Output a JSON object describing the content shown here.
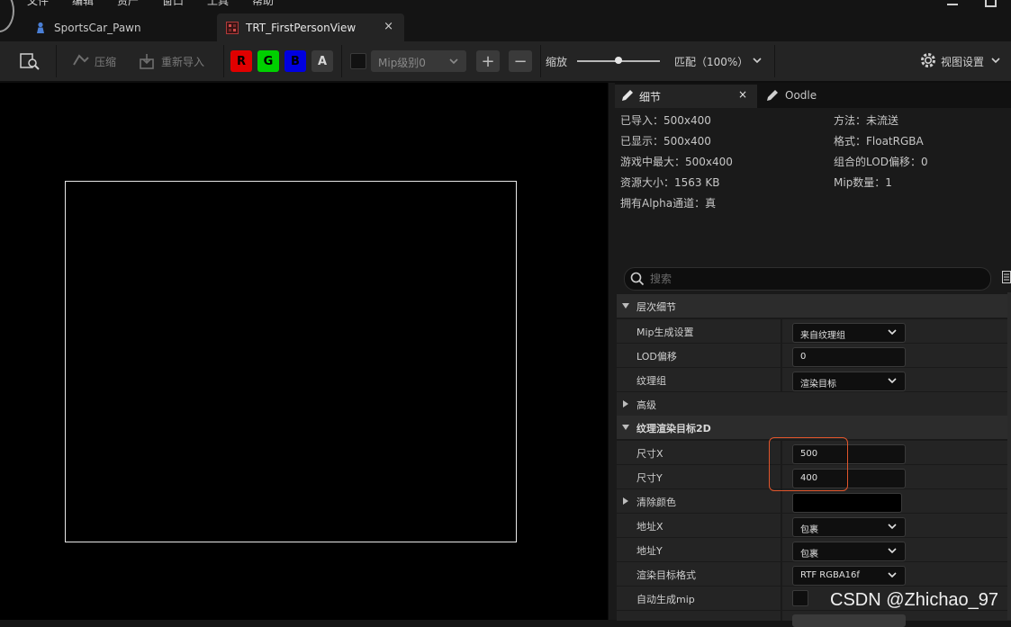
{
  "menu": {
    "items": [
      "文件",
      "编辑",
      "资产",
      "窗口",
      "工具",
      "帮助"
    ]
  },
  "tabs": [
    {
      "label": "SportsCar_Pawn",
      "icon": "pawn-icon"
    },
    {
      "label": "TRT_FirstPersonView",
      "icon": "render-target-icon",
      "close": "×"
    }
  ],
  "toolbar": {
    "compress_label": "压缩",
    "reimport_label": "重新导入",
    "channels": {
      "r": "R",
      "g": "G",
      "b": "B",
      "a": "A"
    },
    "mip_dropdown": "Mip级别0",
    "plus": "+",
    "minus": "−",
    "zoom_label": "缩放",
    "zoom_level": 0.5,
    "fit_label": "匹配（100%）",
    "view_settings_label": "视图设置"
  },
  "details_tabs": {
    "details": "细节",
    "close": "×",
    "oodle": "Oodle"
  },
  "info": {
    "imported": "已导入：500x400",
    "displayed": "已显示：500x400",
    "max_ingame": "游戏中最大：500x400",
    "resource_size": "资源大小：1563 KB",
    "has_alpha": "拥有Alpha通道：真",
    "method": "方法：未流送",
    "format": "格式：FloatRGBA",
    "lod_bias": "组合的LOD偏移：0",
    "mip_count": "Mip数量：1"
  },
  "search": {
    "placeholder": "搜索"
  },
  "sections": {
    "lod": {
      "title": "层次细节",
      "mip_gen_label": "Mip生成设置",
      "mip_gen_value": "来自纹理组",
      "lod_bias_label": "LOD偏移",
      "lod_bias_value": "0",
      "texture_group_label": "纹理组",
      "texture_group_value": "渲染目标"
    },
    "advanced": {
      "title": "高级"
    },
    "rt2d": {
      "title": "纹理渲染目标2D",
      "size_x_label": "尺寸X",
      "size_x_value": "500",
      "size_y_label": "尺寸Y",
      "size_y_value": "400",
      "clear_color_label": "清除颜色",
      "address_x_label": "地址X",
      "address_x_value": "包裹",
      "address_y_label": "地址Y",
      "address_y_value": "包裹",
      "rt_format_label": "渲染目标格式",
      "rt_format_value": "RTF RGBA16f",
      "auto_mip_label": "自动生成mip"
    }
  },
  "watermark": "CSDN @Zhichao_97",
  "colors": {
    "highlight": "#e0552b",
    "channel_r": "#e00000",
    "channel_g": "#00d000",
    "channel_b": "#0000e0"
  }
}
